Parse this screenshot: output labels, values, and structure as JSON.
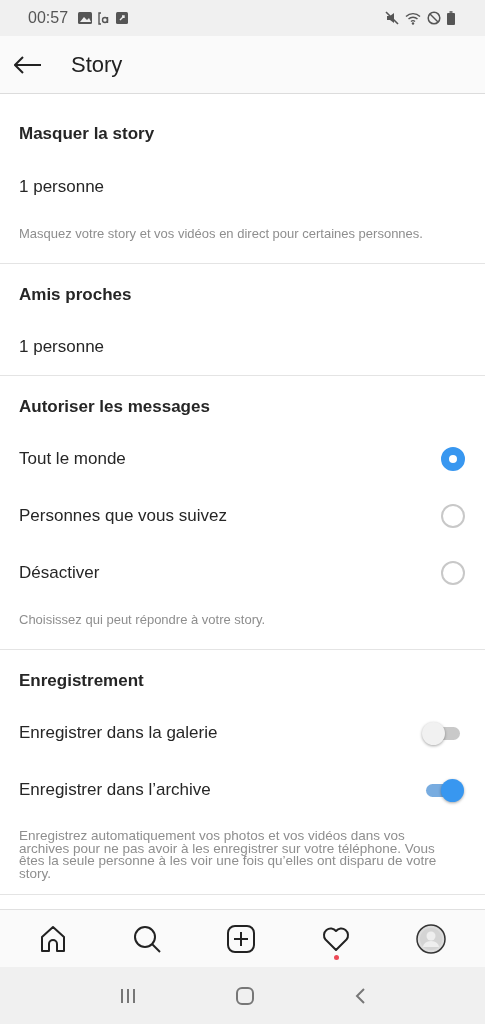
{
  "status_bar": {
    "time": "00:57"
  },
  "header": {
    "title": "Story"
  },
  "sections": [
    {
      "title": "Masquer la story",
      "items": [
        {
          "kind": "link",
          "label": "1 personne"
        }
      ],
      "note": "Masquez votre story et vos vidéos en direct pour certaines personnes."
    },
    {
      "title": "Amis proches",
      "items": [
        {
          "kind": "link",
          "label": "1 personne"
        }
      ]
    },
    {
      "title": "Autoriser les messages",
      "items": [
        {
          "kind": "radio",
          "label": "Tout le monde",
          "selected": true
        },
        {
          "kind": "radio",
          "label": "Personnes que vous suivez",
          "selected": false
        },
        {
          "kind": "radio",
          "label": "Désactiver",
          "selected": false
        }
      ],
      "note": "Choisissez qui peut répondre à votre story."
    },
    {
      "title": "Enregistrement",
      "items": [
        {
          "kind": "toggle",
          "label": "Enregistrer dans la galerie",
          "on": false
        },
        {
          "kind": "toggle",
          "label": "Enregistrer dans l’archive",
          "on": true
        }
      ],
      "note": "Enregistrez automatiquement vos photos et vos vidéos dans vos archives pour ne pas avoir à les enregistrer sur votre téléphone. Vous êtes la seule personne à les voir une fois qu’elles ont disparu de votre story."
    }
  ],
  "bottom_nav": {
    "notification_dot": true
  }
}
